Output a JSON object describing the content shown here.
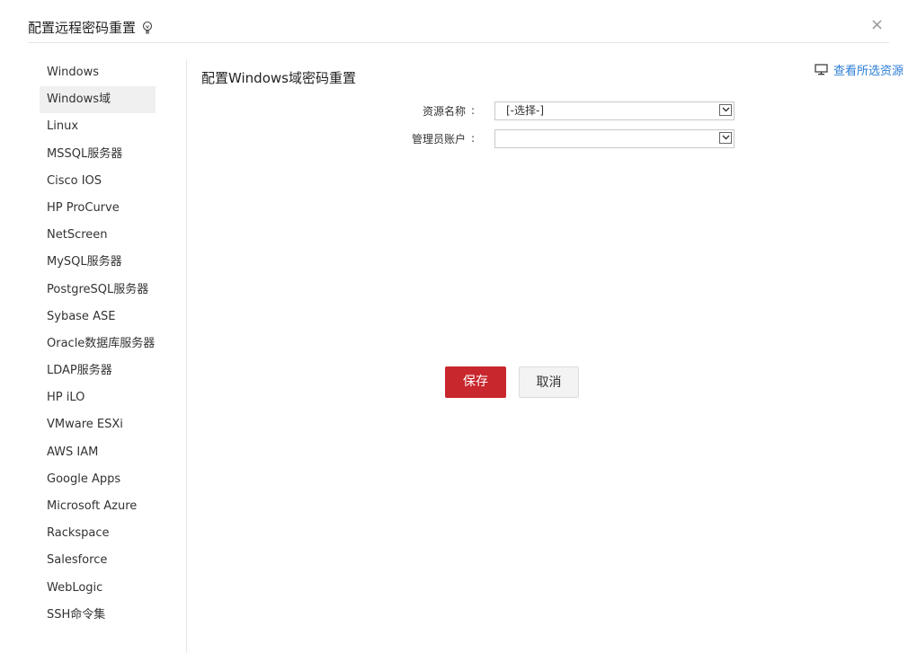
{
  "dialog": {
    "title": "配置远程密码重置",
    "close_label": "×"
  },
  "sidebar": {
    "items": [
      {
        "label": "Windows"
      },
      {
        "label": "Windows域",
        "active": true
      },
      {
        "label": "Linux"
      },
      {
        "label": "MSSQL服务器"
      },
      {
        "label": "Cisco IOS"
      },
      {
        "label": "HP ProCurve"
      },
      {
        "label": "NetScreen"
      },
      {
        "label": "MySQL服务器"
      },
      {
        "label": "PostgreSQL服务器"
      },
      {
        "label": "Sybase ASE"
      },
      {
        "label": "Oracle数据库服务器"
      },
      {
        "label": "LDAP服务器"
      },
      {
        "label": "HP iLO"
      },
      {
        "label": "VMware ESXi"
      },
      {
        "label": "AWS IAM"
      },
      {
        "label": "Google Apps"
      },
      {
        "label": "Microsoft Azure"
      },
      {
        "label": "Rackspace"
      },
      {
        "label": "Salesforce"
      },
      {
        "label": "WebLogic"
      },
      {
        "label": "SSH命令集"
      }
    ]
  },
  "main": {
    "section_title": "配置Windows域密码重置",
    "view_link": "查看所选资源",
    "form": {
      "colon": ":",
      "resource_label": "资源名称",
      "resource_value": "[-选择-]",
      "admin_label": "管理员账户",
      "admin_value": ""
    },
    "buttons": {
      "save": "保存",
      "cancel": "取消"
    }
  },
  "colors": {
    "accent_red": "#c8272d",
    "link_blue": "#2b7ed6"
  },
  "icons": {
    "title": "lightbulb-icon",
    "view_link": "monitor-icon",
    "select_arrow": "chevron-down-icon"
  }
}
